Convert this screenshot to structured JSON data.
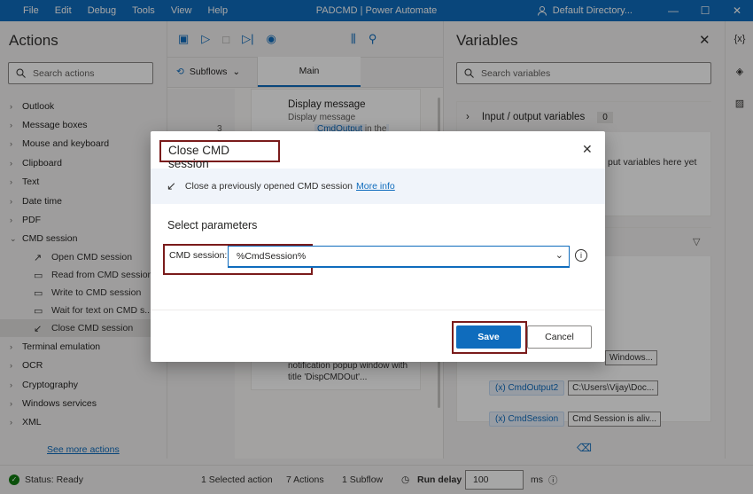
{
  "menu": [
    "File",
    "Edit",
    "Debug",
    "Tools",
    "View",
    "Help"
  ],
  "app_title": "PADCMD | Power Automate",
  "user": "Default Directory...",
  "window_controls": {
    "minimize": "—",
    "maximize": "☐",
    "close": "✕"
  },
  "actions": {
    "title": "Actions",
    "search_placeholder": "Search actions",
    "groups": [
      {
        "label": "Outlook"
      },
      {
        "label": "Message boxes"
      },
      {
        "label": "Mouse and keyboard"
      },
      {
        "label": "Clipboard"
      },
      {
        "label": "Text"
      },
      {
        "label": "Date time"
      },
      {
        "label": "PDF"
      },
      {
        "label": "CMD session"
      }
    ],
    "cmd_items": [
      {
        "label": "Open CMD session",
        "icon": "open-arrow-icon"
      },
      {
        "label": "Read from CMD session",
        "icon": "cmd-icon"
      },
      {
        "label": "Write to CMD session",
        "icon": "cmd-icon"
      },
      {
        "label": "Wait for text on CMD s...",
        "icon": "cmd-icon"
      },
      {
        "label": "Close CMD session",
        "icon": "close-arrow-icon"
      }
    ],
    "groups_after": [
      {
        "label": "Terminal emulation"
      },
      {
        "label": "OCR"
      },
      {
        "label": "Cryptography"
      },
      {
        "label": "Windows services"
      },
      {
        "label": "XML"
      }
    ],
    "see_more": "See more actions"
  },
  "designer": {
    "subflows_label": "Subflows",
    "main_tab": "Main",
    "line_no": "3",
    "step_title": "Display message",
    "step_sub": "Display message",
    "step_var": "CmdOutput",
    "step_sub_tail": "in the",
    "step_desc": "notification popup window with title 'DispCMDOut'..."
  },
  "variables": {
    "title": "Variables",
    "search_placeholder": "Search variables",
    "io_title": "Input / output variables",
    "io_count": "0",
    "io_empty": "put variables here yet",
    "rows": [
      {
        "name": "",
        "value": "Windows..."
      },
      {
        "name": "CmdOutput2",
        "value": "C:\\Users\\Vijay\\Doc..."
      },
      {
        "name": "CmdSession",
        "value": "Cmd Session is aliv..."
      }
    ]
  },
  "dialog": {
    "title": "Close CMD session",
    "description": "Close a previously opened CMD session",
    "more_info": "More info",
    "section": "Select parameters",
    "param_label": "CMD session:",
    "param_value": "%CmdSession%",
    "save": "Save",
    "cancel": "Cancel"
  },
  "status": {
    "ready": "Status: Ready",
    "selected": "1 Selected action",
    "actions_count": "7 Actions",
    "subflow_count": "1 Subflow",
    "run_delay_label": "Run delay",
    "run_delay_value": "100",
    "unit": "ms"
  },
  "colors": {
    "accent": "#0f6cbd",
    "highlight_box": "#7a1b1b",
    "status_ok": "#107c10"
  }
}
